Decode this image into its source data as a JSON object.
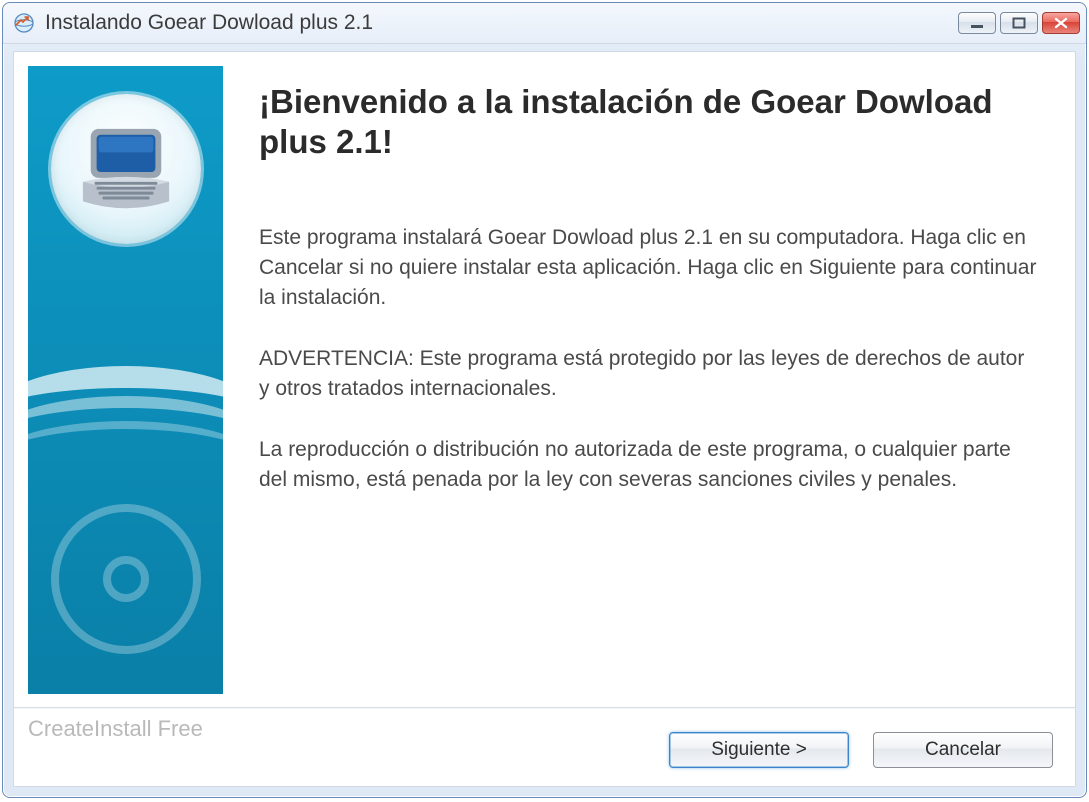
{
  "window": {
    "title": "Instalando Goear Dowload plus 2.1"
  },
  "content": {
    "heading": "¡Bienvenido a la instalación de Goear Dowload plus 2.1!",
    "paragraph1": "Este programa instalará Goear Dowload plus 2.1 en su computadora. Haga clic en Cancelar si no quiere instalar esta aplicación. Haga clic en Siguiente para continuar la instalación.",
    "paragraph2": "ADVERTENCIA: Este programa está protegido por las leyes de derechos de autor y otros tratados internacionales.",
    "paragraph3": "La reproducción o distribución no autorizada de este programa, o cualquier parte del mismo, está penada por la ley con severas sanciones civiles y penales."
  },
  "footer": {
    "brand": "CreateInstall Free",
    "next_label": "Siguiente >",
    "cancel_label": "Cancelar"
  }
}
